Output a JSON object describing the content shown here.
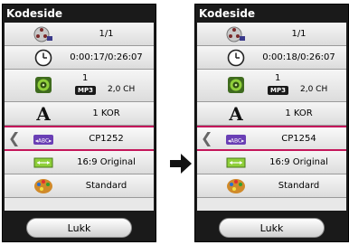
{
  "panels": [
    {
      "title": "Kodeside",
      "rows": {
        "chapter": "1/1",
        "time": "0:00:17/0:26:07",
        "audio_track": "1",
        "audio_format": "MP3",
        "audio_channels": "2,0 CH",
        "subtitle_lang": "1 KOR",
        "codepage": "CP1252",
        "aspect": "16:9 Original",
        "picture_mode": "Standard"
      },
      "close_label": "Lukk"
    },
    {
      "title": "Kodeside",
      "rows": {
        "chapter": "1/1",
        "time": "0:00:18/0:26:07",
        "audio_track": "1",
        "audio_format": "MP3",
        "audio_channels": "2,0 CH",
        "subtitle_lang": "1 KOR",
        "codepage": "CP1254",
        "aspect": "16:9 Original",
        "picture_mode": "Standard"
      },
      "close_label": "Lukk"
    }
  ],
  "icons": {
    "chapter": "film-reel-icon",
    "time": "clock-icon",
    "audio": "speaker-icon",
    "subtitle": "letter-a-icon",
    "codepage": "abc-tag-icon",
    "aspect": "aspect-ratio-icon",
    "picture": "palette-icon",
    "transition": "right-arrow-icon",
    "selector": "chevron-left-icon"
  },
  "colors": {
    "selection": "#c4165a",
    "panel_bg": "#1a1a1a"
  }
}
